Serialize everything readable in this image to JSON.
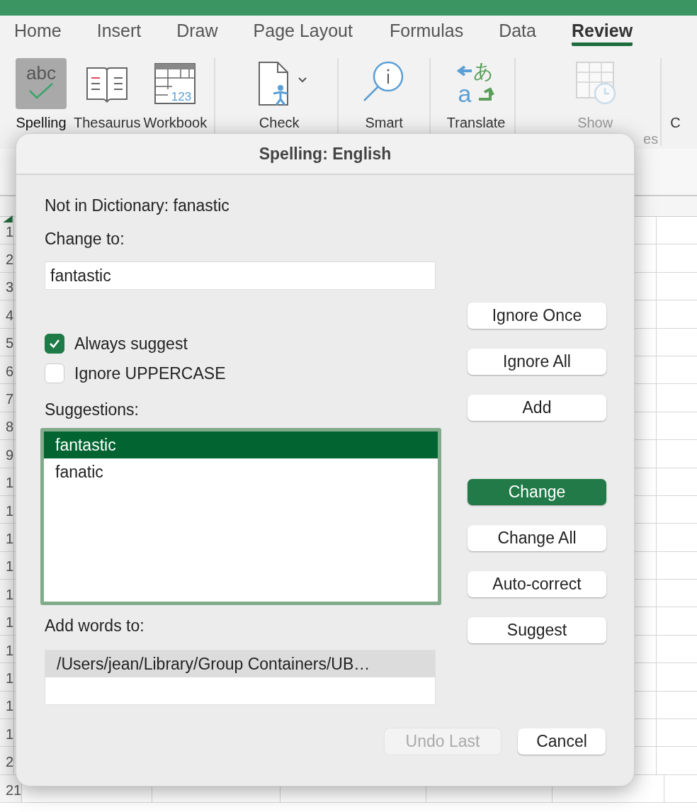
{
  "tabs": [
    {
      "label": "Home",
      "selected": false
    },
    {
      "label": "Insert",
      "selected": false
    },
    {
      "label": "Draw",
      "selected": false
    },
    {
      "label": "Page Layout",
      "selected": false
    },
    {
      "label": "Formulas",
      "selected": false
    },
    {
      "label": "Data",
      "selected": false
    },
    {
      "label": "Review",
      "selected": true
    }
  ],
  "ribbon": {
    "groups": [
      {
        "items": [
          {
            "kind": "spelling",
            "lines": [
              "Spelling"
            ],
            "glyphs": [
              "abc"
            ],
            "selected": true,
            "disabled": false
          },
          {
            "kind": "thesaurus",
            "lines": [
              "Thesaurus"
            ],
            "selected": false,
            "disabled": false
          },
          {
            "kind": "workbook",
            "lines": [
              "Workbook"
            ],
            "glyphs": [
              "123"
            ],
            "selected": false,
            "disabled": false
          }
        ]
      },
      {
        "items": [
          {
            "kind": "check",
            "lines": [
              "Check"
            ],
            "selected": false,
            "disabled": false
          }
        ]
      },
      {
        "items": [
          {
            "kind": "smart",
            "lines": [
              "Smart"
            ],
            "selected": false,
            "disabled": false
          }
        ]
      },
      {
        "items": [
          {
            "kind": "translate",
            "lines": [
              "Translate"
            ],
            "glyphs": [
              "あ",
              "a"
            ],
            "selected": false,
            "disabled": false
          }
        ]
      },
      {
        "items": [
          {
            "kind": "show",
            "lines": [
              "Show",
              "es"
            ],
            "selected": false,
            "disabled": true
          }
        ]
      },
      {
        "items": [
          {
            "kind": "none",
            "lines": [
              "C"
            ],
            "selected": false,
            "disabled": false
          }
        ]
      }
    ]
  },
  "sheet": {
    "row_headers": [
      "1",
      "2",
      "3",
      "4",
      "5",
      "6",
      "7",
      "8",
      "9",
      "1",
      "1",
      "1",
      "1",
      "1",
      "1",
      "1",
      "1",
      "1",
      "1",
      "2",
      "21"
    ]
  },
  "dialog": {
    "title": "Spelling: English",
    "not_in_dictionary": "Not in Dictionary: fanastic",
    "change_to_label": "Change to:",
    "change_to_value": "fantastic",
    "options": [
      {
        "label": "Always suggest",
        "checked": true
      },
      {
        "label": "Ignore UPPERCASE",
        "checked": false
      }
    ],
    "suggestions_label": "Suggestions:",
    "suggestions": [
      {
        "text": "fantastic",
        "selected": true
      },
      {
        "text": "fanatic",
        "selected": false
      }
    ],
    "add_words_label": "Add words to:",
    "dictionaries": [
      {
        "text": "/Users/jean/Library/Group Containers/UB…",
        "selected": true
      }
    ],
    "side_buttons": [
      {
        "label": "Ignore Once",
        "kind": "plain"
      },
      {
        "label": "Ignore All",
        "kind": "plain"
      },
      {
        "label": "Add",
        "kind": "plain"
      },
      {
        "label": "Change",
        "kind": "primary"
      },
      {
        "label": "Change All",
        "kind": "plain"
      },
      {
        "label": "Auto-correct",
        "kind": "plain"
      },
      {
        "label": "Suggest",
        "kind": "plain"
      }
    ],
    "bottom_buttons": [
      {
        "label": "Undo Last",
        "kind": "disabled"
      },
      {
        "label": "Cancel",
        "kind": "plain"
      }
    ]
  }
}
